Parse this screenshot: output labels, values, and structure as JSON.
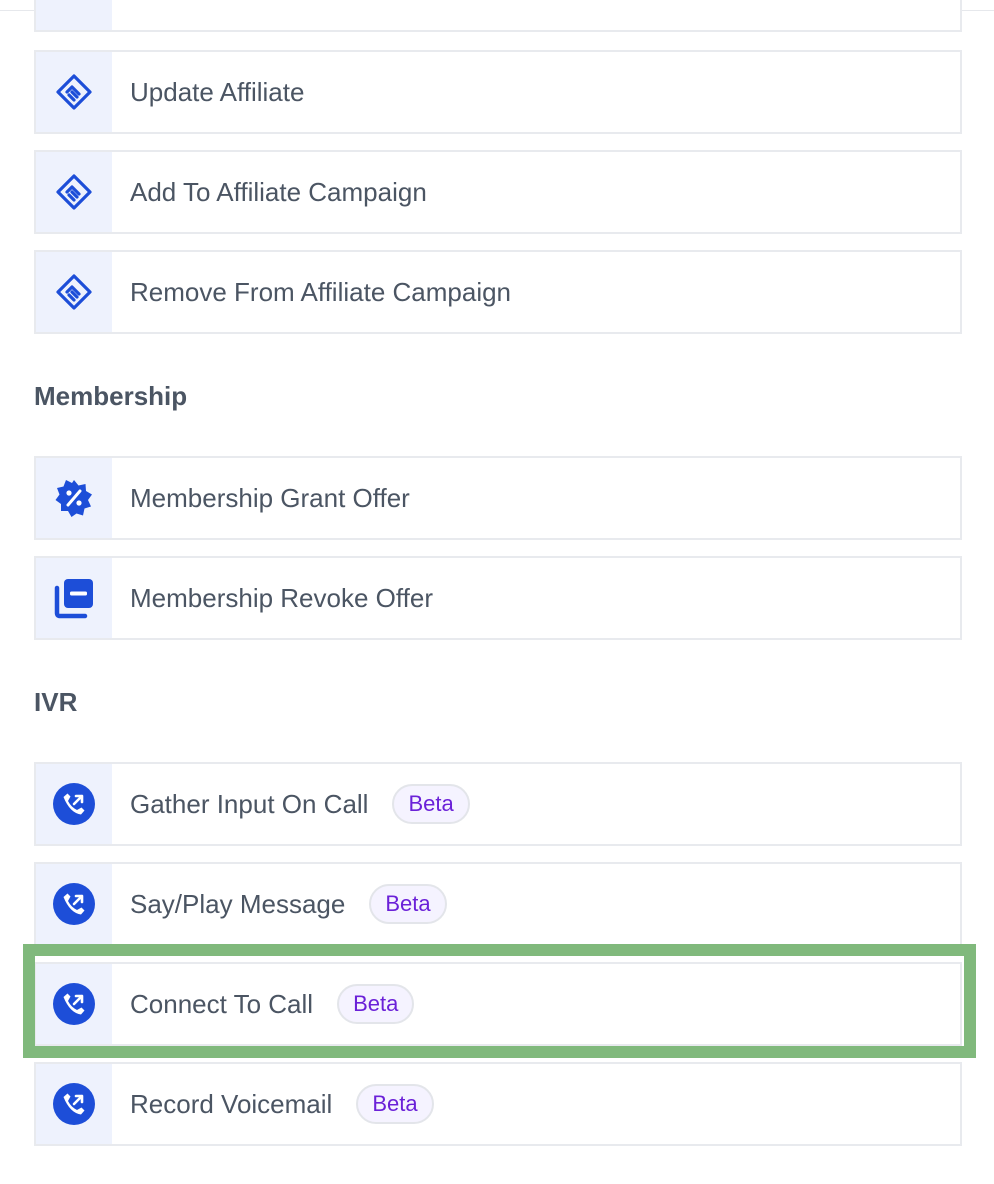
{
  "affiliate_items": [
    {
      "label": "Update Affiliate",
      "icon": "handshake-icon"
    },
    {
      "label": "Add To Affiliate Campaign",
      "icon": "handshake-icon"
    },
    {
      "label": "Remove From Affiliate Campaign",
      "icon": "handshake-icon"
    }
  ],
  "membership": {
    "title": "Membership",
    "items": [
      {
        "label": "Membership Grant Offer",
        "icon": "discount-badge-icon"
      },
      {
        "label": "Membership Revoke Offer",
        "icon": "stacked-minus-icon"
      }
    ]
  },
  "ivr": {
    "title": "IVR",
    "items": [
      {
        "label": "Gather Input On Call",
        "badge": "Beta",
        "icon": "phone-outgoing-icon"
      },
      {
        "label": "Say/Play Message",
        "badge": "Beta",
        "icon": "phone-outgoing-icon"
      },
      {
        "label": "Connect To Call",
        "badge": "Beta",
        "icon": "phone-outgoing-icon"
      },
      {
        "label": "Record Voicemail",
        "badge": "Beta",
        "icon": "phone-outgoing-icon"
      }
    ]
  },
  "colors": {
    "icon_blue": "#1d4ed8",
    "icon_bg": "#eef2fd",
    "badge_text": "#6b21d8",
    "highlight": "#80b97c"
  }
}
